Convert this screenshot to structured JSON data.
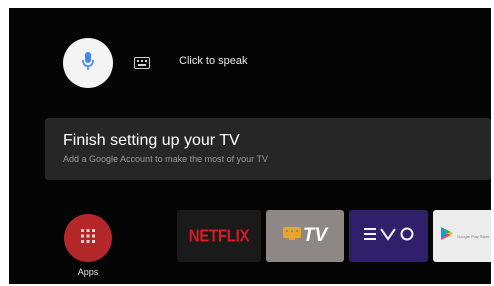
{
  "assistant": {
    "voice_icon": "microphone-icon",
    "keyboard_icon": "keyboard-icon",
    "prompt": "Click to speak"
  },
  "setup_card": {
    "title": "Finish setting up your TV",
    "subtitle": "Add a Google Account to make the most of your TV"
  },
  "apps": {
    "label": "Apps",
    "icon": "grid-icon"
  },
  "tiles": [
    {
      "name": "Netflix",
      "logo_text": "NETFLIX",
      "color": "#d31c24"
    },
    {
      "name": "TV",
      "logo_text": "TV",
      "color": "#8d8785"
    },
    {
      "name": "EVO",
      "logo_text": "EVO",
      "color": "#301f6b"
    },
    {
      "name": "Google Play Store",
      "logo_text": "Google Play Store",
      "color": "#ececec"
    }
  ],
  "colors": {
    "screen_bg": "#050505",
    "card_bg": "#262626",
    "apps_red": "#b5282a",
    "mic_blue": "#4285f4"
  }
}
